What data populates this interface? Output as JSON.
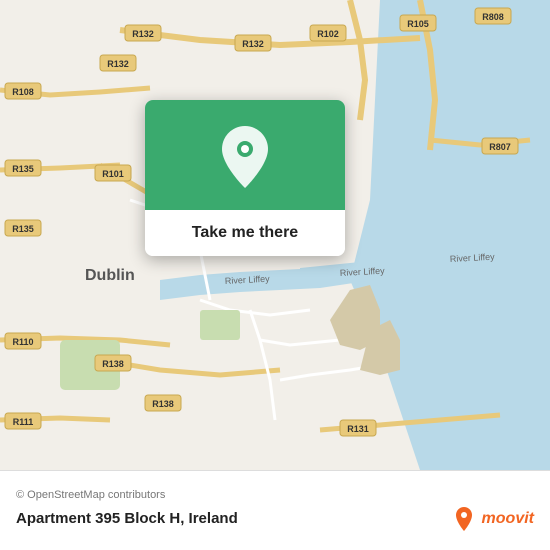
{
  "map": {
    "card": {
      "button_label": "Take me there"
    },
    "attribution": "© OpenStreetMap contributors"
  },
  "bottom_bar": {
    "address": "Apartment 395 Block H, Ireland",
    "moovit_label": "moovit"
  },
  "colors": {
    "map_green": "#3aaa6e",
    "moovit_orange": "#f26522"
  }
}
